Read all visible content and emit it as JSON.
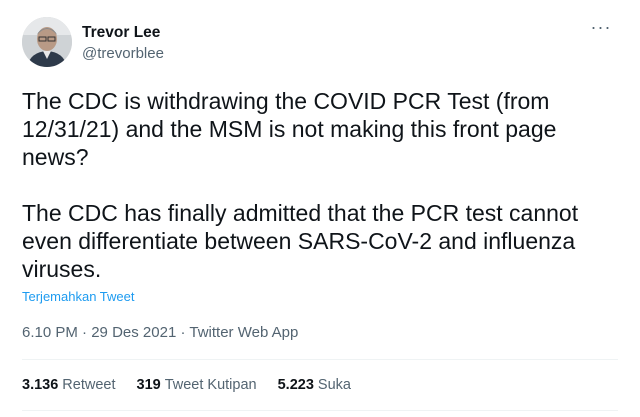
{
  "user": {
    "display_name": "Trevor Lee",
    "handle": "@trevorblee",
    "avatar_icon": "user-avatar-photo"
  },
  "more_icon": "ellipsis-icon",
  "tweet_text": "The CDC is withdrawing the COVID PCR Test (from 12/31/21) and the MSM is not making this front page news?\n\nThe CDC has finally admitted that the PCR test cannot even differentiate between SARS-CoV-2 and influenza viruses.",
  "translate_label": "Terjemahkan Tweet",
  "meta": {
    "time": "6.10 PM",
    "separator": "·",
    "date": "29 Des 2021",
    "source": "Twitter Web App"
  },
  "stats": [
    {
      "value": "3.136",
      "label": "Retweet"
    },
    {
      "value": "319",
      "label": "Tweet Kutipan"
    },
    {
      "value": "5.223",
      "label": "Suka"
    }
  ],
  "colors": {
    "link": "#1d9bf0",
    "secondary_text": "#536471",
    "primary_text": "#0f1419",
    "divider": "#eff3f4"
  }
}
